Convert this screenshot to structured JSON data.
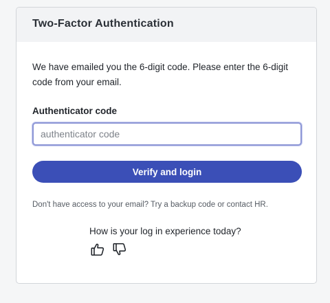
{
  "card": {
    "title": "Two-Factor Authentication",
    "intro": "We have emailed you the 6-digit code. Please enter the 6-digit code from your email.",
    "field_label": "Authenticator code",
    "input_placeholder": "authenticator code",
    "input_value": "",
    "verify_button_label": "Verify and login",
    "help_text": "Don't have access to your email? Try a backup code or contact HR."
  },
  "feedback": {
    "question": "How is your log in experience today?",
    "icons": [
      "thumbs-up-icon",
      "thumbs-down-icon"
    ]
  },
  "colors": {
    "accent": "#3b4fb7",
    "input_focus_border": "#8e97d6",
    "header_bg": "#f2f3f5"
  }
}
